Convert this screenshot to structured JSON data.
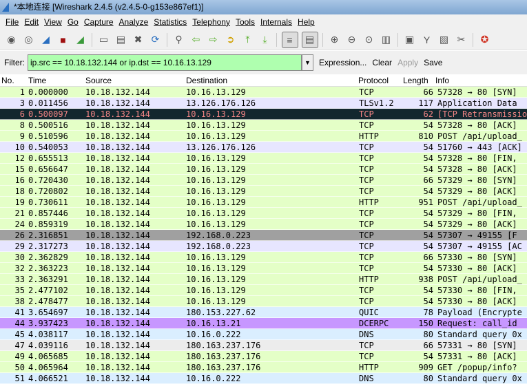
{
  "title": "*本地连接 [Wireshark 2.4.5 (v2.4.5-0-g153e867ef1)]",
  "menu": [
    "File",
    "Edit",
    "View",
    "Go",
    "Capture",
    "Analyze",
    "Statistics",
    "Telephony",
    "Tools",
    "Internals",
    "Help"
  ],
  "toolbar": [
    "interfaces-icon",
    "options-icon",
    "start-capture-icon",
    "stop-capture-icon",
    "restart-capture-icon",
    "|",
    "open-icon",
    "save-icon",
    "close-icon",
    "reload-icon",
    "|",
    "find-icon",
    "back-icon",
    "forward-icon",
    "goto-icon",
    "first-icon",
    "last-icon",
    "|",
    "colorize-icon",
    "autoscroll-icon",
    "|",
    "zoom-in-icon",
    "zoom-out-icon",
    "zoom-normal-icon",
    "resize-columns-icon",
    "|",
    "capture-filters-icon",
    "display-filters-icon",
    "coloring-rules-icon",
    "preferences-icon",
    "|",
    "help-icon"
  ],
  "filter": {
    "label": "Filter:",
    "value": "ip.src == 10.18.132.144 or ip.dst == 10.16.13.129",
    "expression": "Expression...",
    "clear": "Clear",
    "apply": "Apply",
    "save": "Save"
  },
  "columns": {
    "no": "No.",
    "time": "Time",
    "source": "Source",
    "destination": "Destination",
    "protocol": "Protocol",
    "length": "Length",
    "info": "Info"
  },
  "colors": {
    "tcp": "#e4ffc7",
    "tls": "#e7e6ff",
    "bad": "#12272e",
    "bad_text": "#f78787",
    "fin": "#a0a0a0",
    "udp": "#daeeff",
    "dcerpc": "#c797ff",
    "syn": "#ececec"
  },
  "packets": [
    {
      "no": "1",
      "time": "0.000000",
      "src": "10.18.132.144",
      "dst": "10.16.13.129",
      "proto": "TCP",
      "len": "66",
      "info": "57328 → 80 [SYN]",
      "color": "tcp"
    },
    {
      "no": "3",
      "time": "0.011456",
      "src": "10.18.132.144",
      "dst": "13.126.176.126",
      "proto": "TLSv1.2",
      "len": "117",
      "info": "Application Data",
      "color": "tls"
    },
    {
      "no": "6",
      "time": "0.500097",
      "src": "10.18.132.144",
      "dst": "10.16.13.129",
      "proto": "TCP",
      "len": "62",
      "info": "[TCP Retransmission]",
      "color": "bad"
    },
    {
      "no": "8",
      "time": "0.500516",
      "src": "10.18.132.144",
      "dst": "10.16.13.129",
      "proto": "TCP",
      "len": "54",
      "info": "57328 → 80 [ACK]",
      "color": "tcp"
    },
    {
      "no": "9",
      "time": "0.510596",
      "src": "10.18.132.144",
      "dst": "10.16.13.129",
      "proto": "HTTP",
      "len": "810",
      "info": "POST /api/upload_",
      "color": "tcp"
    },
    {
      "no": "10",
      "time": "0.540053",
      "src": "10.18.132.144",
      "dst": "13.126.176.126",
      "proto": "TCP",
      "len": "54",
      "info": "51760 → 443 [ACK]",
      "color": "tls"
    },
    {
      "no": "12",
      "time": "0.655513",
      "src": "10.18.132.144",
      "dst": "10.16.13.129",
      "proto": "TCP",
      "len": "54",
      "info": "57328 → 80 [FIN,",
      "color": "tcp"
    },
    {
      "no": "15",
      "time": "0.656647",
      "src": "10.18.132.144",
      "dst": "10.16.13.129",
      "proto": "TCP",
      "len": "54",
      "info": "57328 → 80 [ACK]",
      "color": "tcp"
    },
    {
      "no": "16",
      "time": "0.720430",
      "src": "10.18.132.144",
      "dst": "10.16.13.129",
      "proto": "TCP",
      "len": "66",
      "info": "57329 → 80 [SYN]",
      "color": "tcp"
    },
    {
      "no": "18",
      "time": "0.720802",
      "src": "10.18.132.144",
      "dst": "10.16.13.129",
      "proto": "TCP",
      "len": "54",
      "info": "57329 → 80 [ACK]",
      "color": "tcp"
    },
    {
      "no": "19",
      "time": "0.730611",
      "src": "10.18.132.144",
      "dst": "10.16.13.129",
      "proto": "HTTP",
      "len": "951",
      "info": "POST /api/upload_",
      "color": "tcp"
    },
    {
      "no": "21",
      "time": "0.857446",
      "src": "10.18.132.144",
      "dst": "10.16.13.129",
      "proto": "TCP",
      "len": "54",
      "info": "57329 → 80 [FIN,",
      "color": "tcp"
    },
    {
      "no": "24",
      "time": "0.859319",
      "src": "10.18.132.144",
      "dst": "10.16.13.129",
      "proto": "TCP",
      "len": "54",
      "info": "57329 → 80 [ACK]",
      "color": "tcp"
    },
    {
      "no": "26",
      "time": "2.316851",
      "src": "10.18.132.144",
      "dst": "192.168.0.223",
      "proto": "TCP",
      "len": "54",
      "info": "57307 → 49155 [F",
      "color": "fin"
    },
    {
      "no": "29",
      "time": "2.317273",
      "src": "10.18.132.144",
      "dst": "192.168.0.223",
      "proto": "TCP",
      "len": "54",
      "info": "57307 → 49155 [AC",
      "color": "tls"
    },
    {
      "no": "30",
      "time": "2.362829",
      "src": "10.18.132.144",
      "dst": "10.16.13.129",
      "proto": "TCP",
      "len": "66",
      "info": "57330 → 80 [SYN]",
      "color": "tcp"
    },
    {
      "no": "32",
      "time": "2.363223",
      "src": "10.18.132.144",
      "dst": "10.16.13.129",
      "proto": "TCP",
      "len": "54",
      "info": "57330 → 80 [ACK]",
      "color": "tcp"
    },
    {
      "no": "33",
      "time": "2.363291",
      "src": "10.18.132.144",
      "dst": "10.16.13.129",
      "proto": "HTTP",
      "len": "938",
      "info": "POST /api/upload_",
      "color": "tcp"
    },
    {
      "no": "35",
      "time": "2.477102",
      "src": "10.18.132.144",
      "dst": "10.16.13.129",
      "proto": "TCP",
      "len": "54",
      "info": "57330 → 80 [FIN,",
      "color": "tcp"
    },
    {
      "no": "38",
      "time": "2.478477",
      "src": "10.18.132.144",
      "dst": "10.16.13.129",
      "proto": "TCP",
      "len": "54",
      "info": "57330 → 80 [ACK]",
      "color": "tcp"
    },
    {
      "no": "41",
      "time": "3.654697",
      "src": "10.18.132.144",
      "dst": "180.153.227.62",
      "proto": "QUIC",
      "len": "78",
      "info": "Payload (Encrypte",
      "color": "udp"
    },
    {
      "no": "44",
      "time": "3.937423",
      "src": "10.18.132.144",
      "dst": "10.16.13.21",
      "proto": "DCERPC",
      "len": "150",
      "info": "Request: call_id",
      "color": "dcerpc"
    },
    {
      "no": "45",
      "time": "4.038117",
      "src": "10.18.132.144",
      "dst": "10.16.0.222",
      "proto": "DNS",
      "len": "80",
      "info": "Standard query 0x",
      "color": "udp"
    },
    {
      "no": "47",
      "time": "4.039116",
      "src": "10.18.132.144",
      "dst": "180.163.237.176",
      "proto": "TCP",
      "len": "66",
      "info": "57331 → 80 [SYN]",
      "color": "syn"
    },
    {
      "no": "49",
      "time": "4.065685",
      "src": "10.18.132.144",
      "dst": "180.163.237.176",
      "proto": "TCP",
      "len": "54",
      "info": "57331 → 80 [ACK]",
      "color": "tcp"
    },
    {
      "no": "50",
      "time": "4.065964",
      "src": "10.18.132.144",
      "dst": "180.163.237.176",
      "proto": "HTTP",
      "len": "909",
      "info": "GET /popup/info?",
      "color": "tcp"
    },
    {
      "no": "51",
      "time": "4.066521",
      "src": "10.18.132.144",
      "dst": "10.16.0.222",
      "proto": "DNS",
      "len": "80",
      "info": "Standard query 0x",
      "color": "udp"
    }
  ]
}
